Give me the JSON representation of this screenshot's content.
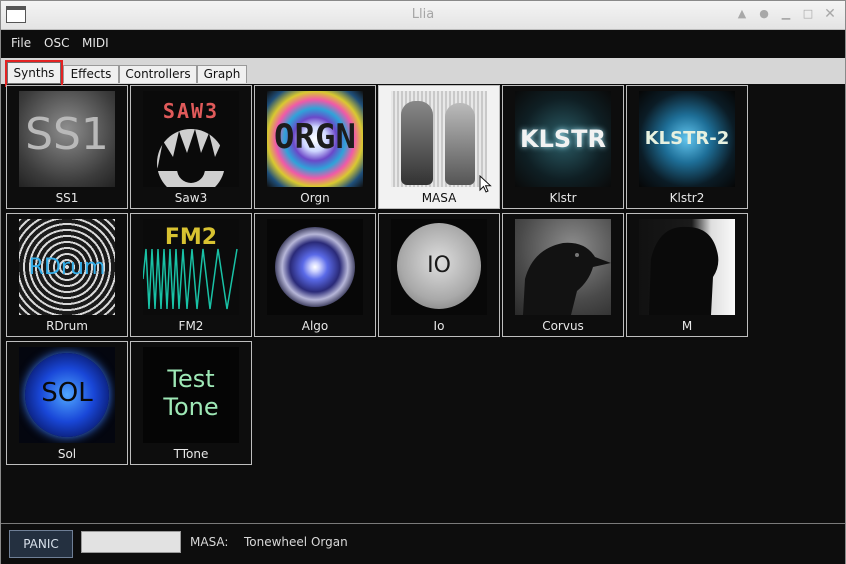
{
  "window": {
    "title": "Llia"
  },
  "menu": [
    "File",
    "OSC",
    "MIDI"
  ],
  "tabs": [
    "Synths",
    "Effects",
    "Controllers",
    "Graph"
  ],
  "synths": [
    {
      "name": "SS1",
      "icon": "ss1-thumbnail",
      "text": "SS1"
    },
    {
      "name": "Saw3",
      "icon": "saw3-thumbnail",
      "text": "SAW3"
    },
    {
      "name": "Orgn",
      "icon": "orgn-thumbnail",
      "text": "ORGN"
    },
    {
      "name": "MASA",
      "icon": "masa-thumbnail",
      "text": ""
    },
    {
      "name": "Klstr",
      "icon": "klstr-thumbnail",
      "text": "KLSTR"
    },
    {
      "name": "Klstr2",
      "icon": "klstr2-thumbnail",
      "text": "KLSTR-2"
    },
    {
      "name": "RDrum",
      "icon": "rdrum-thumbnail",
      "text": "RDrum"
    },
    {
      "name": "FM2",
      "icon": "fm2-thumbnail",
      "text": "FM2"
    },
    {
      "name": "Algo",
      "icon": "algo-thumbnail",
      "text": ""
    },
    {
      "name": "Io",
      "icon": "io-thumbnail",
      "text": "IO"
    },
    {
      "name": "Corvus",
      "icon": "corvus-thumbnail",
      "text": ""
    },
    {
      "name": "M",
      "icon": "m-thumbnail",
      "text": ""
    },
    {
      "name": "Sol",
      "icon": "sol-thumbnail",
      "text": "SOL"
    },
    {
      "name": "TTone",
      "icon": "ttone-thumbnail",
      "text": "Test Tone"
    }
  ],
  "selected": "MASA",
  "status": {
    "panic_label": "PANIC",
    "field_value": "",
    "synth_label": "MASA:",
    "description": "Tonewheel Organ"
  },
  "colors": {
    "background": "#0d0d0d",
    "highlight": "#e32222",
    "panic": "#243040"
  }
}
